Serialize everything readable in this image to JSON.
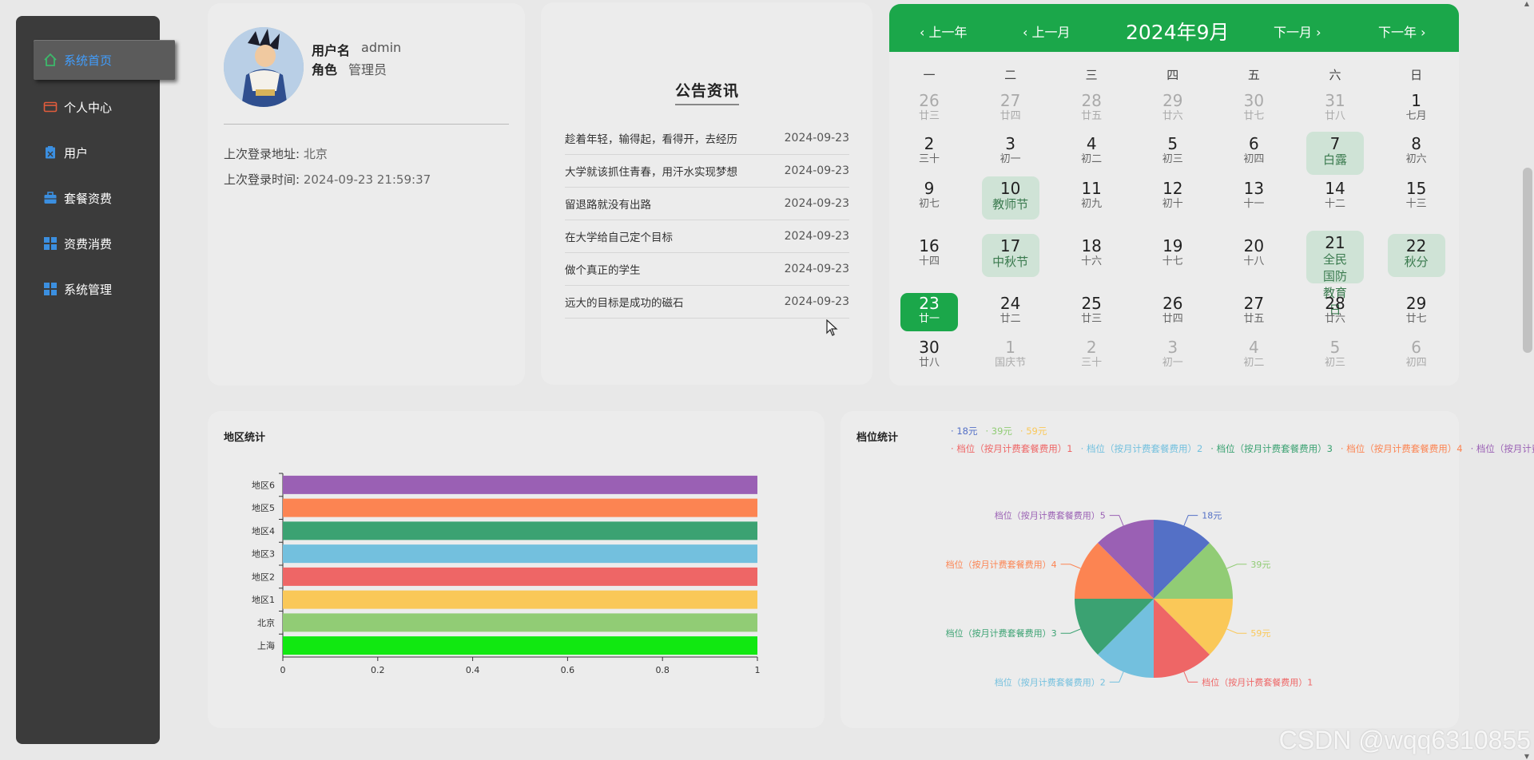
{
  "sidebar": {
    "items": [
      {
        "label": "系统首页",
        "icon": "home-icon",
        "color": "#3db86b",
        "active": true
      },
      {
        "label": "个人中心",
        "icon": "wallet-icon",
        "color": "#e25c3c"
      },
      {
        "label": "用户",
        "icon": "clipboard-icon",
        "color": "#3b8fe0"
      },
      {
        "label": "套餐资费",
        "icon": "briefcase-icon",
        "color": "#3b8fe0"
      },
      {
        "label": "资费消费",
        "icon": "grid-icon",
        "color": "#3b8fe0"
      },
      {
        "label": "系统管理",
        "icon": "grid-icon",
        "color": "#3b8fe0"
      }
    ]
  },
  "user": {
    "name_label": "用户名",
    "name_value": "admin",
    "role_label": "角色",
    "role_value": "管理员",
    "last_addr_label": "上次登录地址:",
    "last_addr_value": "北京",
    "last_time_label": "上次登录时间:",
    "last_time_value": "2024-09-23 21:59:37"
  },
  "news": {
    "title": "公告资讯",
    "items": [
      {
        "text": "趁着年轻，输得起，看得开，去经历",
        "date": "2024-09-23"
      },
      {
        "text": "大学就该抓住青春，用汗水实现梦想",
        "date": "2024-09-23"
      },
      {
        "text": "留退路就没有出路",
        "date": "2024-09-23"
      },
      {
        "text": "在大学给自己定个目标",
        "date": "2024-09-23"
      },
      {
        "text": "做个真正的学生",
        "date": "2024-09-23"
      },
      {
        "text": "远大的目标是成功的磁石",
        "date": "2024-09-23"
      }
    ]
  },
  "calendar": {
    "prev_year": "上一年",
    "prev_month": "上一月",
    "title": "2024年9月",
    "next_month": "下一月",
    "next_year": "下一年",
    "weekdays": [
      "一",
      "二",
      "三",
      "四",
      "五",
      "六",
      "日"
    ],
    "weeks": [
      [
        {
          "n": "26",
          "s": "廿三",
          "dim": true
        },
        {
          "n": "27",
          "s": "廿四",
          "dim": true
        },
        {
          "n": "28",
          "s": "廿五",
          "dim": true
        },
        {
          "n": "29",
          "s": "廿六",
          "dim": true
        },
        {
          "n": "30",
          "s": "廿七",
          "dim": true
        },
        {
          "n": "31",
          "s": "廿八",
          "dim": true
        },
        {
          "n": "1",
          "s": "七月"
        }
      ],
      [
        {
          "n": "2",
          "s": "三十"
        },
        {
          "n": "3",
          "s": "初一"
        },
        {
          "n": "4",
          "s": "初二"
        },
        {
          "n": "5",
          "s": "初三"
        },
        {
          "n": "6",
          "s": "初四"
        },
        {
          "n": "7",
          "s": "白露",
          "hl": true
        },
        {
          "n": "8",
          "s": "初六"
        }
      ],
      [
        {
          "n": "9",
          "s": "初七"
        },
        {
          "n": "10",
          "s": "教师节",
          "hl": true
        },
        {
          "n": "11",
          "s": "初九"
        },
        {
          "n": "12",
          "s": "初十"
        },
        {
          "n": "13",
          "s": "十一"
        },
        {
          "n": "14",
          "s": "十二"
        },
        {
          "n": "15",
          "s": "十三"
        }
      ],
      [
        {
          "n": "16",
          "s": "十四"
        },
        {
          "n": "17",
          "s": "中秋节",
          "hl": true
        },
        {
          "n": "18",
          "s": "十六"
        },
        {
          "n": "19",
          "s": "十七"
        },
        {
          "n": "20",
          "s": "十八"
        },
        {
          "n": "21",
          "s": "全民国防教育日",
          "hl": true
        },
        {
          "n": "22",
          "s": "秋分",
          "hl": true
        }
      ],
      [
        {
          "n": "23",
          "s": "廿一",
          "today": true
        },
        {
          "n": "24",
          "s": "廿二"
        },
        {
          "n": "25",
          "s": "廿三"
        },
        {
          "n": "26",
          "s": "廿四"
        },
        {
          "n": "27",
          "s": "廿五"
        },
        {
          "n": "28",
          "s": "廿六"
        },
        {
          "n": "29",
          "s": "廿七"
        }
      ],
      [
        {
          "n": "30",
          "s": "廿八"
        },
        {
          "n": "1",
          "s": "国庆节",
          "dim": true
        },
        {
          "n": "2",
          "s": "三十",
          "dim": true
        },
        {
          "n": "3",
          "s": "初一",
          "dim": true
        },
        {
          "n": "4",
          "s": "初二",
          "dim": true
        },
        {
          "n": "5",
          "s": "初三",
          "dim": true
        },
        {
          "n": "6",
          "s": "初四",
          "dim": true
        }
      ]
    ]
  },
  "watermark": "CSDN @wqq6310855",
  "chart_data": [
    {
      "type": "bar",
      "orientation": "horizontal",
      "title": "地区统计",
      "categories": [
        "上海",
        "北京",
        "地区1",
        "地区2",
        "地区3",
        "地区4",
        "地区5",
        "地区6"
      ],
      "values": [
        1,
        1,
        1,
        1,
        1,
        1,
        1,
        1
      ],
      "colors": [
        "#11e811",
        "#91cc75",
        "#fac858",
        "#ee6666",
        "#73c0de",
        "#3ba272",
        "#fc8452",
        "#9a60b4"
      ],
      "xlim": [
        0,
        1
      ],
      "xticks": [
        "0",
        "0.2",
        "0.4",
        "0.6",
        "0.8",
        "1"
      ]
    },
    {
      "type": "pie",
      "title": "档位统计",
      "labels": [
        "18元",
        "39元",
        "59元",
        "档位（按月计费套餐费用）1",
        "档位（按月计费套餐费用）2",
        "档位（按月计费套餐费用）3",
        "档位（按月计费套餐费用）4",
        "档位（按月计费套餐费用）5"
      ],
      "values": [
        1,
        1,
        1,
        1,
        1,
        1,
        1,
        1
      ],
      "colors": [
        "#5470c6",
        "#91cc75",
        "#fac858",
        "#ee6666",
        "#73c0de",
        "#3ba272",
        "#fc8452",
        "#9a60b4"
      ],
      "legend_position": "top-right"
    }
  ]
}
